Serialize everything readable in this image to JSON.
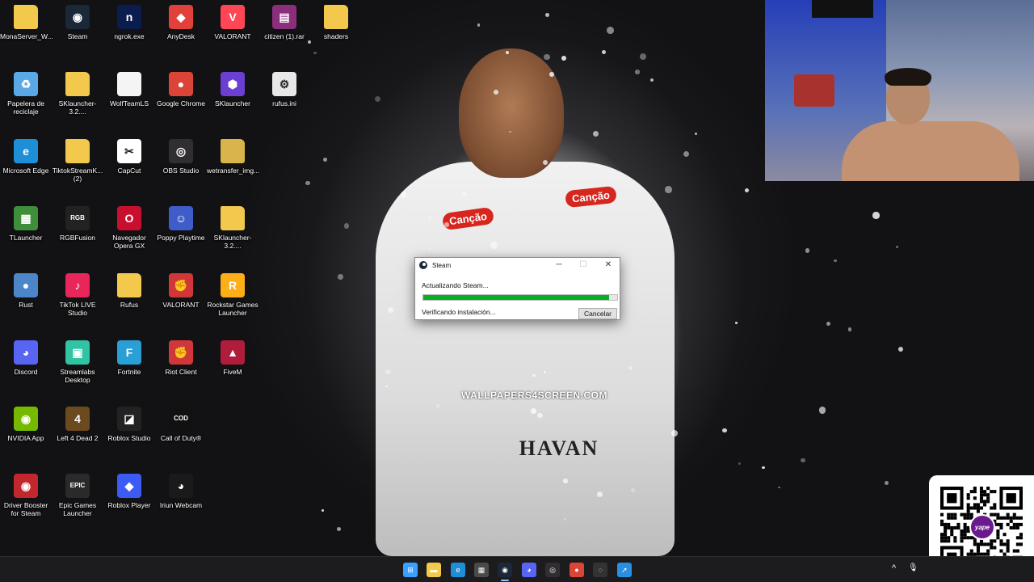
{
  "desktop": {
    "icons": [
      {
        "label": "MonaServer_W...",
        "icon": "folder-icon",
        "glyph": "",
        "color": "#f2c94c"
      },
      {
        "label": "Steam",
        "icon": "steam-icon",
        "glyph": "◉",
        "color": "#1b2838"
      },
      {
        "label": "ngrok.exe",
        "icon": "ngrok-icon",
        "glyph": "n",
        "color": "#0b1d4f"
      },
      {
        "label": "AnyDesk",
        "icon": "anydesk-icon",
        "glyph": "◆",
        "color": "#e2413b"
      },
      {
        "label": "VALORANT",
        "icon": "valorant-icon",
        "glyph": "V",
        "color": "#ff4655"
      },
      {
        "label": "citizen (1).rar",
        "icon": "winrar-icon",
        "glyph": "▤",
        "color": "#8b2f7c"
      },
      {
        "label": "shaders",
        "icon": "folder-icon",
        "glyph": "",
        "color": "#f2c94c"
      },
      {
        "label": "Papelera de reciclaje",
        "icon": "recycle-bin-icon",
        "glyph": "♻",
        "color": "#5aa9e6"
      },
      {
        "label": "SKlauncher-3.2....",
        "icon": "folder-icon",
        "glyph": "",
        "color": "#f2c94c"
      },
      {
        "label": "WolfTeamLS",
        "icon": "file-icon",
        "glyph": "",
        "color": "#f4f4f4"
      },
      {
        "label": "Google Chrome",
        "icon": "chrome-icon",
        "glyph": "●",
        "color": "#db4437"
      },
      {
        "label": "SKlauncher",
        "icon": "sklauncher-icon",
        "glyph": "⬢",
        "color": "#6a3fd1"
      },
      {
        "label": "rufus.ini",
        "icon": "settings-file-icon",
        "glyph": "⚙",
        "color": "#e8e8e8"
      },
      {
        "label": "Microsoft Edge",
        "icon": "edge-icon",
        "glyph": "e",
        "color": "#1e8fd6"
      },
      {
        "label": "TiktokStreamK... (2)",
        "icon": "folder-icon",
        "glyph": "",
        "color": "#f2c94c"
      },
      {
        "label": "CapCut",
        "icon": "capcut-icon",
        "glyph": "✂",
        "color": "#ffffff"
      },
      {
        "label": "OBS Studio",
        "icon": "obs-icon",
        "glyph": "◎",
        "color": "#302e31"
      },
      {
        "label": "wetransfer_img...",
        "icon": "folder-icon",
        "glyph": "",
        "color": "#d9b44a"
      },
      {
        "label": "TLauncher",
        "icon": "tlauncher-icon",
        "glyph": "▦",
        "color": "#3f8f3a"
      },
      {
        "label": "RGBFusion",
        "icon": "rgbfusion-icon",
        "glyph": "RGB",
        "color": "#222222"
      },
      {
        "label": "Navegador Opera GX",
        "icon": "opera-gx-icon",
        "glyph": "O",
        "color": "#c8102e"
      },
      {
        "label": "Poppy Playtime",
        "icon": "poppy-playtime-icon",
        "glyph": "☺",
        "color": "#3f5dc9"
      },
      {
        "label": "SKlauncher-3.2....",
        "icon": "folder-icon",
        "glyph": "",
        "color": "#f2c94c"
      },
      {
        "label": "Rust",
        "icon": "rust-icon",
        "glyph": "●",
        "color": "#4b86c9"
      },
      {
        "label": "TikTok LIVE Studio",
        "icon": "tiktok-icon",
        "glyph": "♪",
        "color": "#e8265a"
      },
      {
        "label": "Rufus",
        "icon": "folder-icon",
        "glyph": "",
        "color": "#f2c94c"
      },
      {
        "label": "VALORANT",
        "icon": "riot-icon",
        "glyph": "✊",
        "color": "#d13639"
      },
      {
        "label": "Rockstar Games Launcher",
        "icon": "rockstar-icon",
        "glyph": "R",
        "color": "#fcaf17"
      },
      {
        "label": "Discord",
        "icon": "discord-icon",
        "glyph": "◕",
        "color": "#5865f2"
      },
      {
        "label": "Streamlabs Desktop",
        "icon": "streamlabs-icon",
        "glyph": "▣",
        "color": "#31c3a2"
      },
      {
        "label": "Fortnite",
        "icon": "fortnite-icon",
        "glyph": "F",
        "color": "#2a9fd6"
      },
      {
        "label": "Riot Client",
        "icon": "riot-icon",
        "glyph": "✊",
        "color": "#d13639"
      },
      {
        "label": "FiveM",
        "icon": "fivem-icon",
        "glyph": "▲",
        "color": "#b01d3c"
      },
      {
        "label": "NVIDIA App",
        "icon": "nvidia-icon",
        "glyph": "◉",
        "color": "#76b900"
      },
      {
        "label": "Left 4 Dead 2",
        "icon": "left4dead2-icon",
        "glyph": "4",
        "color": "#6b4a1f"
      },
      {
        "label": "Roblox Studio",
        "icon": "roblox-studio-icon",
        "glyph": "◪",
        "color": "#222222"
      },
      {
        "label": "Call of Duty®",
        "icon": "call-of-duty-icon",
        "glyph": "COD",
        "color": "#111111"
      },
      {
        "label": "Driver Booster for Steam",
        "icon": "driver-booster-icon",
        "glyph": "◉",
        "color": "#c1272d"
      },
      {
        "label": "Epic Games Launcher",
        "icon": "epic-games-icon",
        "glyph": "EPIC",
        "color": "#2a2a2a"
      },
      {
        "label": "Roblox Player",
        "icon": "roblox-player-icon",
        "glyph": "◆",
        "color": "#3b5bf4"
      },
      {
        "label": "Iriun Webcam",
        "icon": "iriun-webcam-icon",
        "glyph": "◕",
        "color": "#1a1a1a"
      }
    ]
  },
  "wallpaper": {
    "watermark": "WALLPAPERS4SCREEN.COM",
    "sponsor_left": "Canção",
    "sponsor_right": "Canção",
    "chest_logo": "HAVAN"
  },
  "steam_dialog": {
    "title": "Steam",
    "status": "Actualizando Steam...",
    "progress": 0.96,
    "substatus": "Verificando instalación...",
    "cancel_label": "Cancelar",
    "minimize_label": "─",
    "maximize_label": "☐",
    "close_label": "✕",
    "progress_color": "#06b025"
  },
  "qr": {
    "badge_text": "yape",
    "brand_color": "#6a1a8c"
  },
  "taskbar": {
    "icons": [
      {
        "name": "start-menu-icon",
        "glyph": "⊞",
        "color": "#3aa0ff"
      },
      {
        "name": "file-explorer-icon",
        "glyph": "▬",
        "color": "#f2c94c"
      },
      {
        "name": "edge-icon",
        "glyph": "e",
        "color": "#1e8fd6"
      },
      {
        "name": "microsoft-store-icon",
        "glyph": "▦",
        "color": "#4a4a4a"
      },
      {
        "name": "steam-icon",
        "glyph": "◉",
        "color": "#1b2838"
      },
      {
        "name": "discord-icon",
        "glyph": "◕",
        "color": "#5865f2"
      },
      {
        "name": "obs-icon",
        "glyph": "◎",
        "color": "#302e31"
      },
      {
        "name": "chrome-icon",
        "glyph": "●",
        "color": "#db4437"
      },
      {
        "name": "game-controller-icon",
        "glyph": "◌",
        "color": "#333333"
      },
      {
        "name": "compass-app-icon",
        "glyph": "➚",
        "color": "#2a8fe0"
      }
    ],
    "tray_chevron": "^",
    "tray_mic": "🎙"
  }
}
